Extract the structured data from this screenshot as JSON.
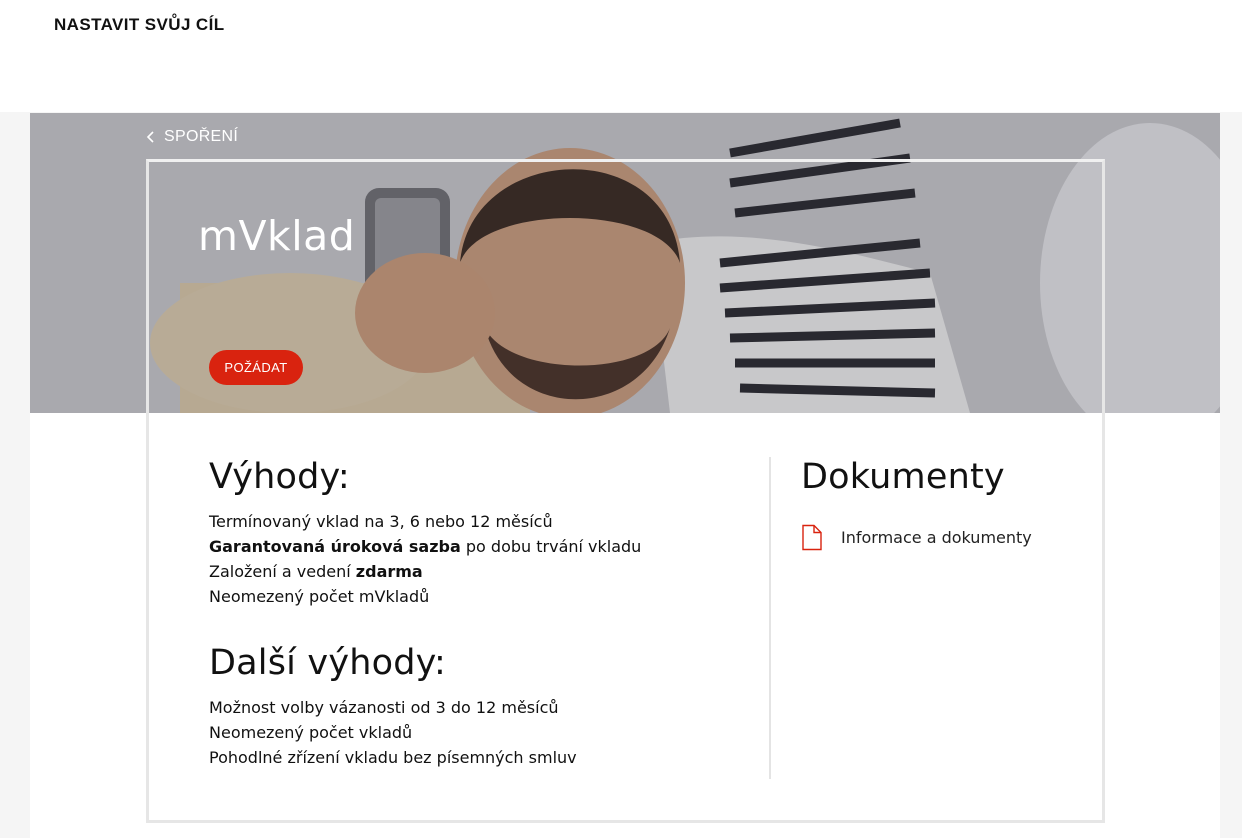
{
  "header": {
    "title": "NASTAVIT SVŮJ CÍL"
  },
  "hero": {
    "back_label": "SPOŘENÍ",
    "product_title": "mVklad",
    "request_button": "POŽÁDAT"
  },
  "benefits": {
    "title": "Výhody:",
    "items": [
      {
        "pre": "Termínovaný vklad na 3, 6 nebo 12 měsíců",
        "bold": "",
        "post": ""
      },
      {
        "pre": "",
        "bold": "Garantovaná úroková sazba",
        "post": " po dobu trvání vkladu"
      },
      {
        "pre": "Založení a vedení ",
        "bold": "zdarma",
        "post": ""
      },
      {
        "pre": "Neomezený počet mVkladů",
        "bold": "",
        "post": ""
      }
    ]
  },
  "more_benefits": {
    "title": "Další výhody:",
    "items": [
      "Možnost volby vázanosti od 3 do 12 měsíců",
      "Neomezený počet vkladů",
      "Pohodlné zřízení vkladu bez písemných smluv"
    ]
  },
  "documents": {
    "title": "Dokumenty",
    "link_label": "Informace a dokumenty",
    "icon": "document-icon"
  },
  "colors": {
    "accent": "#d9230f",
    "frame": "#e6e6e6"
  }
}
